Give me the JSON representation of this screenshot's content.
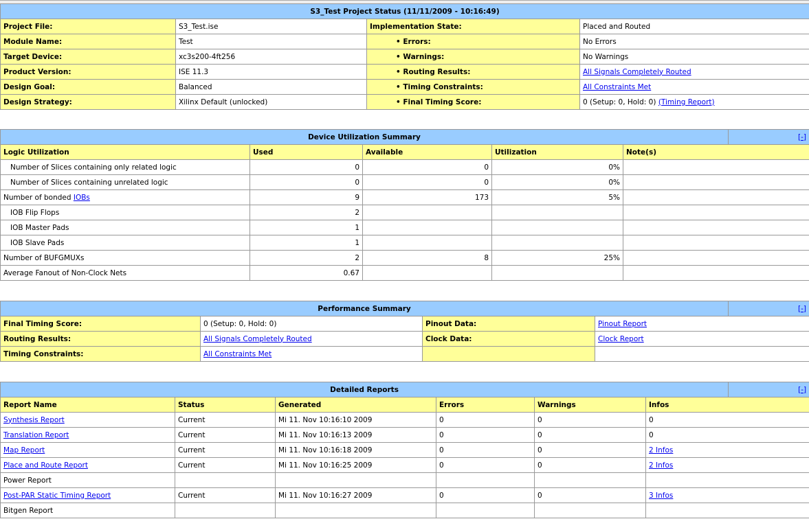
{
  "project_status": {
    "title": "S3_Test Project Status (11/11/2009 - 10:16:49)",
    "rows": [
      [
        "Project File:",
        "S3_Test.ise",
        "Implementation State:",
        "Placed and Routed"
      ],
      [
        "Module Name:",
        "Test",
        "• Errors:",
        "No Errors"
      ],
      [
        "Target Device:",
        "xc3s200-4ft256",
        "• Warnings:",
        "No Warnings"
      ],
      [
        "Product Version:",
        "ISE 11.3",
        "• Routing Results:",
        "All Signals Completely Routed"
      ],
      [
        "Design Goal:",
        "Balanced",
        "• Timing Constraints:",
        "All Constraints Met"
      ],
      [
        "Design Strategy:",
        "Xilinx Default (unlocked)",
        "• Final Timing Score:",
        "0 (Setup: 0, Hold: 0)"
      ]
    ],
    "timing_report_link": "(Timing Report)"
  },
  "device_utilization": {
    "title": "Device Utilization Summary",
    "toggle": "[-]",
    "headers": [
      "Logic Utilization",
      "Used",
      "Available",
      "Utilization",
      "Note(s)"
    ],
    "rows": [
      [
        "Number of Slices containing only related logic",
        "0",
        "0",
        "0%",
        ""
      ],
      [
        "Number of Slices containing unrelated logic",
        "0",
        "0",
        "0%",
        ""
      ],
      [
        "Number of bonded",
        "9",
        "173",
        "5%",
        ""
      ],
      [
        "IOB Flip Flops",
        "2",
        "",
        "",
        ""
      ],
      [
        "IOB Master Pads",
        "1",
        "",
        "",
        ""
      ],
      [
        "IOB Slave Pads",
        "1",
        "",
        "",
        ""
      ],
      [
        "Number of BUFGMUXs",
        "2",
        "8",
        "25%",
        ""
      ],
      [
        "Average Fanout of Non-Clock Nets",
        "0.67",
        "",
        "",
        ""
      ]
    ],
    "iobs_link": "IOBs"
  },
  "performance": {
    "title": "Performance Summary",
    "toggle": "[-]",
    "rows": [
      [
        "Final Timing Score:",
        "0 (Setup: 0, Hold: 0)",
        "Pinout Data:",
        "Pinout Report"
      ],
      [
        "Routing Results:",
        "All Signals Completely Routed",
        "Clock Data:",
        "Clock Report"
      ],
      [
        "Timing Constraints:",
        "All Constraints Met",
        "",
        ""
      ]
    ]
  },
  "detailed_reports": {
    "title": "Detailed Reports",
    "toggle": "[-]",
    "headers": [
      "Report Name",
      "Status",
      "Generated",
      "Errors",
      "Warnings",
      "Infos"
    ],
    "rows": [
      [
        "Synthesis Report",
        "Current",
        "Mi 11. Nov 10:16:10 2009",
        "0",
        "0",
        "0"
      ],
      [
        "Translation Report",
        "Current",
        "Mi 11. Nov 10:16:13 2009",
        "0",
        "0",
        "0"
      ],
      [
        "Map Report",
        "Current",
        "Mi 11. Nov 10:16:18 2009",
        "0",
        "0",
        "2 Infos"
      ],
      [
        "Place and Route Report",
        "Current",
        "Mi 11. Nov 10:16:25 2009",
        "0",
        "0",
        "2 Infos"
      ],
      [
        "Power Report",
        "",
        "",
        "",
        "",
        ""
      ],
      [
        "Post-PAR Static Timing Report",
        "Current",
        "Mi 11. Nov 10:16:27 2009",
        "0",
        "0",
        "3 Infos"
      ],
      [
        "Bitgen Report",
        "",
        "",
        "",
        "",
        ""
      ]
    ]
  }
}
